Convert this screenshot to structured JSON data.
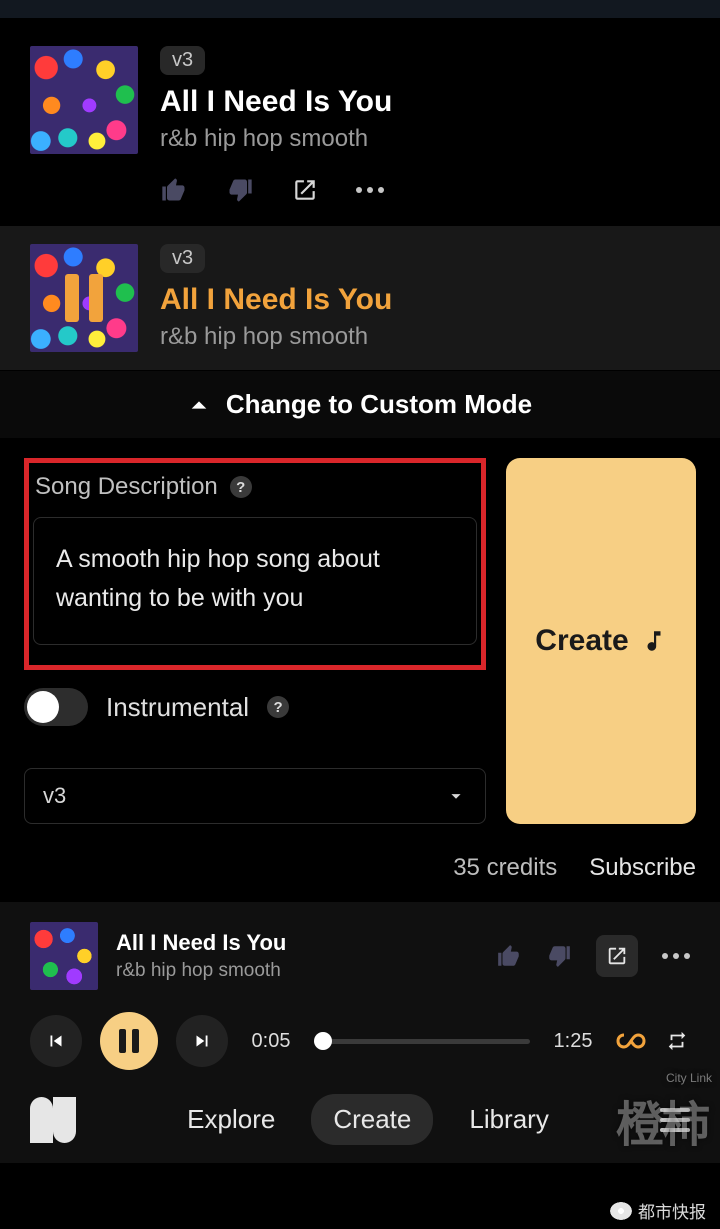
{
  "songs": [
    {
      "badge": "v3",
      "title": "All I Need Is You",
      "tags": "r&b hip hop smooth",
      "selected": false
    },
    {
      "badge": "v3",
      "title": "All I Need Is You",
      "tags": "r&b hip hop smooth",
      "selected": true
    }
  ],
  "custom_mode_label": "Change to Custom Mode",
  "editor": {
    "section_label": "Song Description",
    "description_value": "A smooth hip hop song about wanting to be with you",
    "instrumental_label": "Instrumental",
    "instrumental_on": false,
    "version_selected": "v3",
    "create_label": "Create",
    "credits_text": "35 credits",
    "subscribe_label": "Subscribe"
  },
  "player": {
    "title": "All I Need Is You",
    "tags": "r&b hip hop smooth",
    "current_time": "0:05",
    "duration": "1:25"
  },
  "nav": {
    "items": [
      "Explore",
      "Create",
      "Library"
    ],
    "active": "Create"
  },
  "watermark": {
    "main": "橙柿",
    "city": "City Link",
    "source": "都市快报"
  }
}
